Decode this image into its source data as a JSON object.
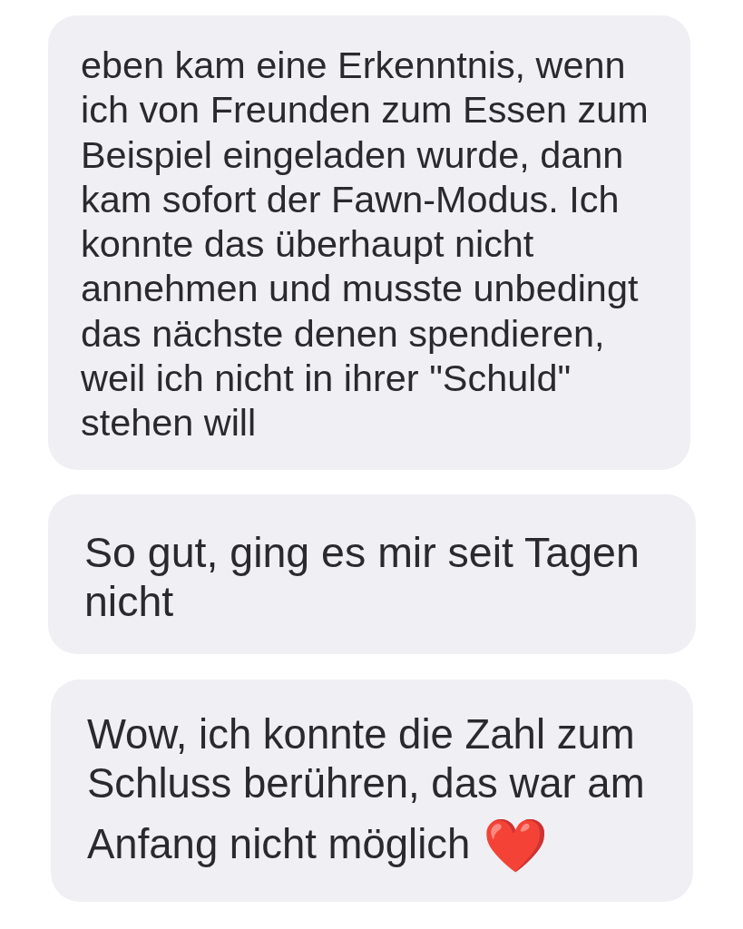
{
  "messages": [
    {
      "text": "eben kam eine Erkenntnis, wenn ich von Freunden zum Essen zum Beispiel eingeladen wurde, dann kam sofort der Fawn-Modus. Ich konnte das überhaupt nicht annehmen und musste unbedingt das nächste denen spendieren, weil ich nicht in ihrer \"Schuld\" stehen will"
    },
    {
      "text": "So gut, ging es mir seit Tagen nicht"
    },
    {
      "text": "Wow, ich konnte die Zahl zum Schluss berühren, das war am Anfang nicht möglich",
      "emoji": "❤️"
    }
  ]
}
